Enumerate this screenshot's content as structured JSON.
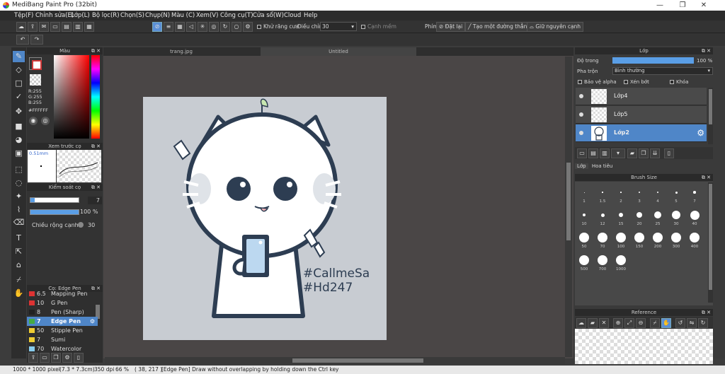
{
  "window": {
    "title": "MediBang Paint Pro (32bit)",
    "minimize": "—",
    "maximize": "❐",
    "close": "✕"
  },
  "menu": [
    "Tệp(F)",
    "Chỉnh sửa(E)",
    "Lớp(L)",
    "Bộ lọc(R)",
    "Chọn(S)",
    "Chụp(N)",
    "Màu (C)",
    "Xem(V)",
    "Công cụ(T)",
    "Cửa sổ(W)",
    "Cloud",
    "Help"
  ],
  "toolbar": {
    "antialias_label": "Khử răng cưa",
    "adjust_label": "Điều chỉnh",
    "adjust_value": "30",
    "soft_edge_label": "Cạnh mềm",
    "key_label": "Phím",
    "reset_label": "Đặt lại",
    "create_line_label": "Tạo một đường thẳng",
    "keep_edge_label": "Giữ nguyên cạnh"
  },
  "color_panel": {
    "title": "Màu",
    "r": "R:255",
    "g": "G:255",
    "b": "B:255",
    "hex": "#FFFFFF",
    "primary_color": "#ffffff",
    "secondary_color": "#d23a3a"
  },
  "brush_preview": {
    "title": "Xem trước cọ",
    "size": "0.51mm"
  },
  "brush_control": {
    "title": "Kiểm soát cọ",
    "size_value": "7",
    "opacity_value": "100 %",
    "edge_width_label": "Chiều rộng cạnh",
    "edge_width_value": "30"
  },
  "brush_list": {
    "title": "Cọ: Edge Pen",
    "items": [
      {
        "size": "6.5",
        "name": "Mapping Pen",
        "color": "#d33"
      },
      {
        "size": "10",
        "name": "G Pen",
        "color": "#d33"
      },
      {
        "size": "8",
        "name": "Pen (Sharp)",
        "color": "#222"
      },
      {
        "size": "7",
        "name": "Edge Pen",
        "color": "#4a4",
        "selected": true
      },
      {
        "size": "50",
        "name": "Stipple Pen",
        "color": "#ec3"
      },
      {
        "size": "7",
        "name": "Sumi",
        "color": "#ec3"
      },
      {
        "size": "70",
        "name": "Watercolor",
        "color": "#8ce"
      }
    ]
  },
  "tabs": [
    {
      "label": "trang.jpg"
    },
    {
      "label": "Untitled"
    }
  ],
  "artwork": {
    "line1": "#CallmeSa",
    "line2": "#Hd247"
  },
  "layer_panel": {
    "title": "Lớp",
    "opacity_label": "Độ trong",
    "opacity_value": "100 %",
    "blend_label": "Pha trộn",
    "blend_value": "Bình thường",
    "protect_alpha": "Bảo vệ alpha",
    "clip": "Xén bớt",
    "lock": "Khóa",
    "layers": [
      {
        "name": "Lớp4"
      },
      {
        "name": "Lớp5"
      },
      {
        "name": "Lớp2",
        "selected": true
      }
    ],
    "tab_layer": "Lớp",
    "tab_navigator": "Hoa tiêu"
  },
  "brush_size": {
    "title": "Brush Size",
    "sizes": [
      "1",
      "1.5",
      "2",
      "3",
      "4",
      "5",
      "7",
      "10",
      "12",
      "15",
      "20",
      "25",
      "30",
      "40",
      "50",
      "70",
      "100",
      "150",
      "200",
      "300",
      "400",
      "500",
      "700",
      "1000"
    ]
  },
  "reference": {
    "title": "Reference"
  },
  "status": {
    "dims": "1000 * 1000 pixel",
    "size_cm": "(7.3 * 7.3cm)",
    "dpi": "350 dpi",
    "zoom": "66 %",
    "coords": "( 38, 217 )",
    "message": "[Edge Pen] Draw without overlapping by holding down the Ctrl key"
  }
}
